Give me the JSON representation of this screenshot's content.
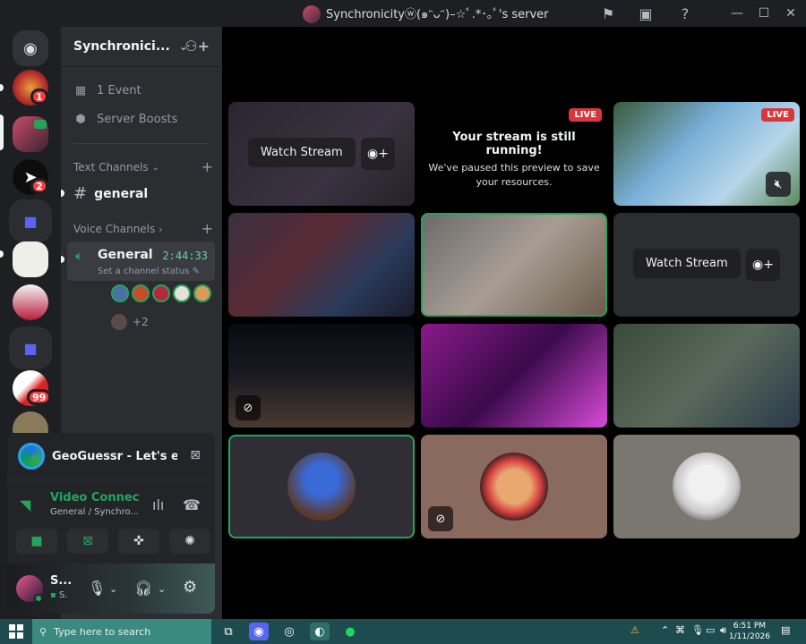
{
  "window": {
    "title": "Synchronicityⓦ(๑ᵔᴗᵔ)–☆ﾟ.*･｡ﾟ's server"
  },
  "server": {
    "name": "Synchronici...",
    "events_label": "1 Event",
    "boosts_label": "Server Boosts"
  },
  "rail": {
    "badges": [
      "1",
      "2",
      "99"
    ]
  },
  "channels": {
    "text_category": "Text Channels",
    "text_channel": "general",
    "voice_category": "Voice Channels",
    "voice_channel": "General",
    "voice_timer": "2:44:33",
    "voice_status_placeholder": "Set a channel status",
    "more_members": "+2"
  },
  "activity": {
    "label": "GeoGuessr - Let's e..."
  },
  "voice_connection": {
    "title": "Video Connected",
    "subtitle": "General / Synchro..."
  },
  "user": {
    "name": "S...",
    "status": "S."
  },
  "stage": {
    "watch_stream_label": "Watch Stream",
    "live_label": "LIVE",
    "paused_title": "Your stream is still running!",
    "paused_text": "We've paused this preview to save your resources."
  },
  "taskbar": {
    "search_placeholder": "Type here to search",
    "time": "6:51 PM",
    "date": "1/11/2026"
  },
  "colors": {
    "accent_green": "#23a55a",
    "live_red": "#da373c",
    "badge_red": "#f23f43",
    "blurple": "#5865f2"
  }
}
